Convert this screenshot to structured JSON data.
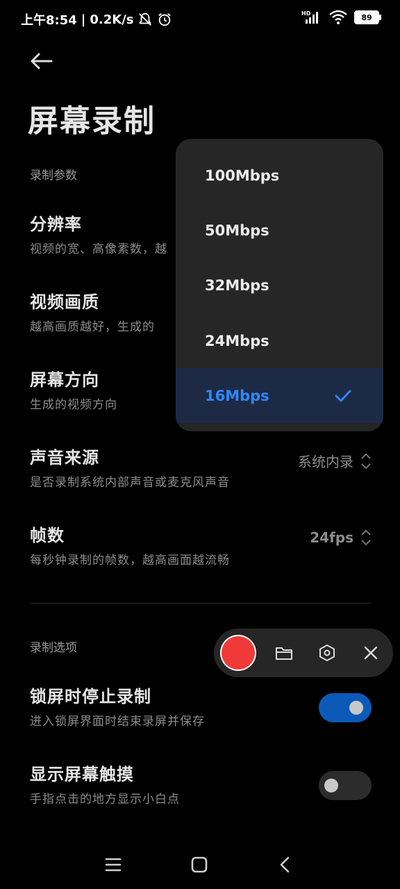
{
  "status_bar": {
    "time": "上午8:54",
    "speed": "0.2K/s",
    "signal_label": "HD",
    "battery": "89"
  },
  "page": {
    "title": "屏幕录制"
  },
  "sections": {
    "params": "录制参数",
    "options": "录制选项"
  },
  "settings": [
    {
      "title": "分辨率",
      "subtitle": "视频的宽、高像素数，越",
      "value": ""
    },
    {
      "title": "视频画质",
      "subtitle": "越高画质越好，生成的",
      "value": ""
    },
    {
      "title": "屏幕方向",
      "subtitle": "生成的视频方向",
      "value": ""
    },
    {
      "title": "声音来源",
      "subtitle": "是否录制系统内部声音或麦克风声音",
      "value": "系统内录"
    },
    {
      "title": "帧数",
      "subtitle": "每秒钟录制的帧数，越高画面越流畅",
      "value": "24fps"
    }
  ],
  "options": [
    {
      "title": "锁屏时停止录制",
      "subtitle": "进入锁屏界面时结束录屏并保存",
      "enabled": true
    },
    {
      "title": "显示屏幕触摸",
      "subtitle": "手指点击的地方显示小白点",
      "enabled": false
    }
  ],
  "dropdown": {
    "options": [
      "100Mbps",
      "50Mbps",
      "32Mbps",
      "24Mbps",
      "16Mbps"
    ],
    "selected": "16Mbps"
  },
  "colors": {
    "accent": "#2f87ff",
    "record": "#f03a3a",
    "toggle_on": "#0c5ab8"
  }
}
